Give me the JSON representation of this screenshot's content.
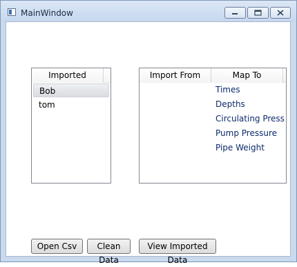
{
  "window": {
    "title": "MainWindow",
    "controls": {
      "minimize": "minimize",
      "maximize": "maximize",
      "close": "close"
    }
  },
  "left_list": {
    "header": "Imported",
    "items": [
      "Bob",
      "tom"
    ],
    "selected_index": 0
  },
  "right_list": {
    "headers": [
      "Import From",
      "Map To"
    ],
    "rows": [
      {
        "from": "",
        "to": "Times"
      },
      {
        "from": "",
        "to": "Depths"
      },
      {
        "from": "",
        "to": "Circulating Press"
      },
      {
        "from": "",
        "to": "Pump Pressure"
      },
      {
        "from": "",
        "to": "Pipe Weight"
      }
    ]
  },
  "buttons": {
    "open_csv": "Open Csv",
    "clean_data": "Clean Data",
    "view_imported": "View Imported Data"
  },
  "icons": {
    "app": "window-app-icon",
    "minimize": "minimize-icon",
    "maximize": "maximize-icon",
    "close": "close-icon"
  }
}
